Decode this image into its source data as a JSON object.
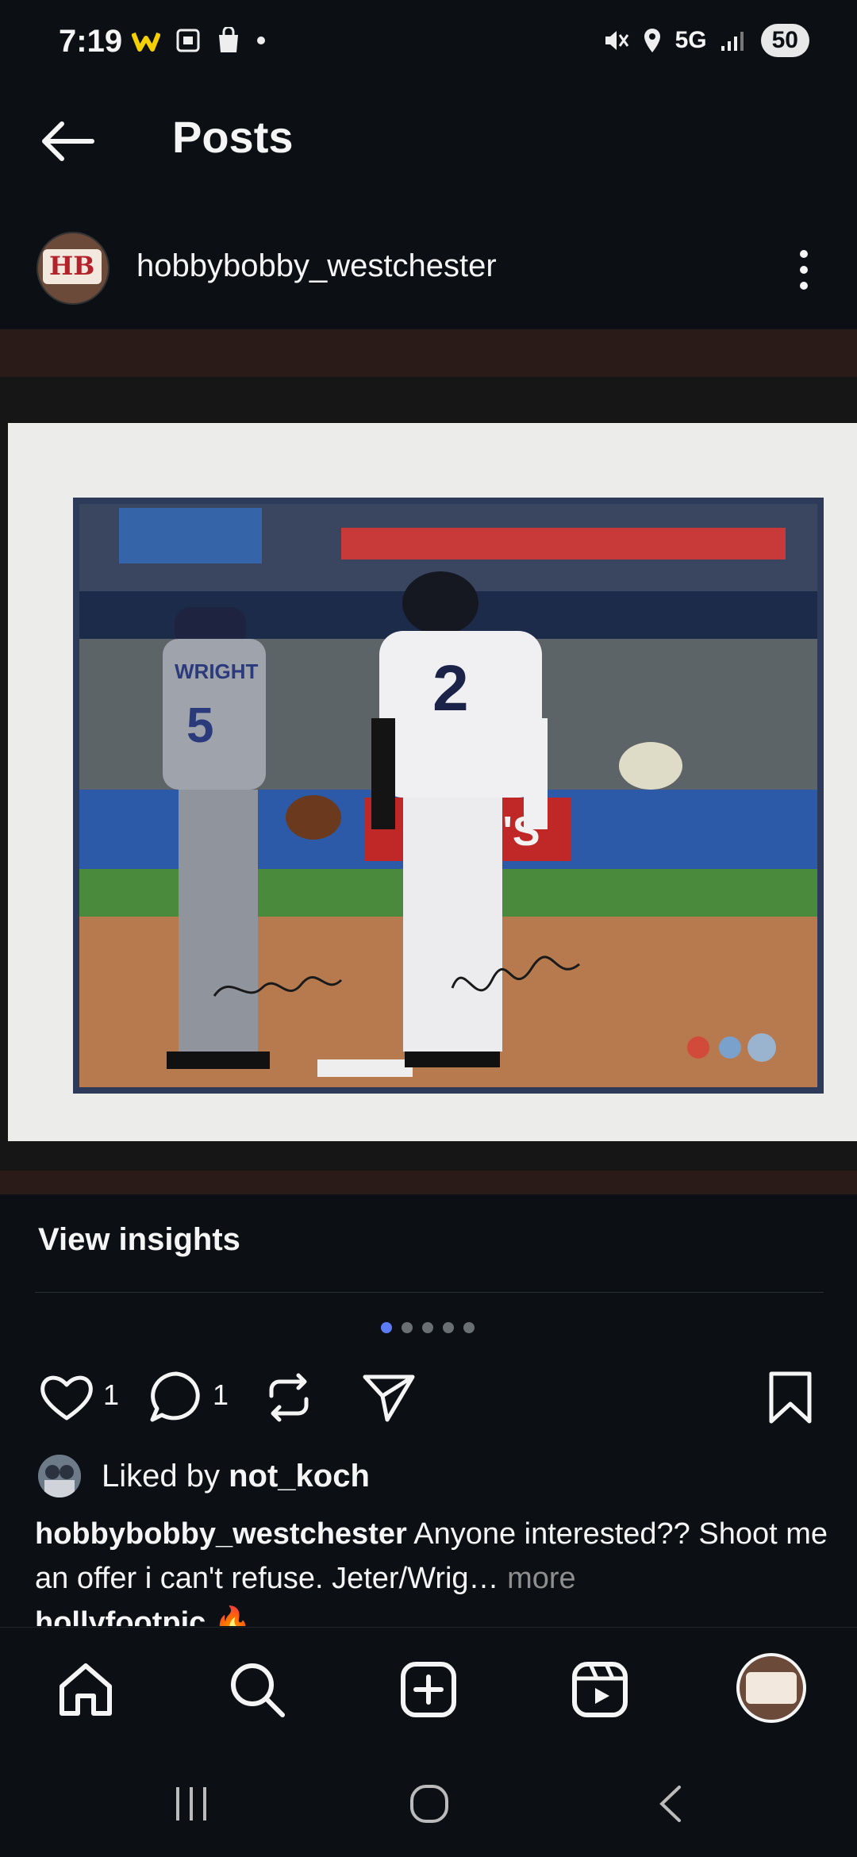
{
  "status_bar": {
    "time": "7:19",
    "network": "5G",
    "battery": "50"
  },
  "header": {
    "title": "Posts"
  },
  "post": {
    "username": "hobbybobby_westchester",
    "view_insights": "View insights",
    "carousel": {
      "total": 5,
      "active": 1
    },
    "likes_count": "1",
    "comments_count": "1",
    "liked_by_prefix": "Liked by ",
    "liked_by_user": "not_koch",
    "caption_user": "hobbybobby_westchester",
    "caption_text": " Anyone interested?? Shoot me an offer i can't refuse. Jeter/Wrig",
    "caption_ellipsis": "…",
    "caption_more": " more",
    "next_comment_peek": "hollyfootpic 🔥",
    "photo_texts": {
      "jersey_left_name": "WRIGHT",
      "jersey_left_number": "5",
      "jersey_right_number": "2",
      "banner_sign": "LL'S"
    },
    "avatar_logo_text": "HB"
  },
  "colors": {
    "background": "#0c1014",
    "text": "#f5f5f5",
    "secondary_text": "#8e8e8e",
    "carousel_active": "#5b7cf5"
  },
  "icons": {
    "back": "arrow-left-icon",
    "more": "more-vertical-icon",
    "like": "heart-icon",
    "comment": "comment-icon",
    "repost": "repost-icon",
    "share": "send-icon",
    "save": "bookmark-icon",
    "home": "home-icon",
    "search": "search-icon",
    "create": "plus-square-icon",
    "reels": "reels-icon",
    "profile": "profile-avatar-icon"
  }
}
